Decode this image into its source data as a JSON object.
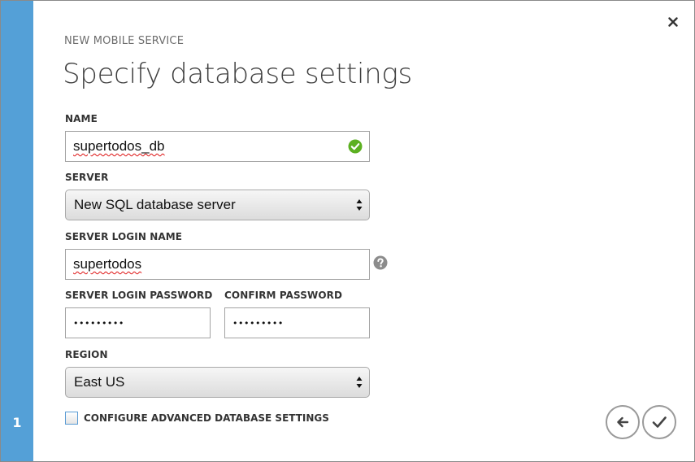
{
  "wizard": {
    "step_number": "1",
    "subtitle": "NEW MOBILE SERVICE",
    "title": "Specify database settings"
  },
  "form": {
    "name": {
      "label": "NAME",
      "value": "supertodos_db",
      "status_icon": "check-circle-icon",
      "status_color": "#5cb021"
    },
    "server": {
      "label": "SERVER",
      "selected": "New SQL database server"
    },
    "server_login_name": {
      "label": "SERVER LOGIN NAME",
      "value": "supertodos",
      "help_icon": "question-circle-icon"
    },
    "server_login_password": {
      "label": "SERVER LOGIN PASSWORD",
      "value": "•••••••••"
    },
    "confirm_password": {
      "label": "CONFIRM PASSWORD",
      "value": "•••••••••"
    },
    "region": {
      "label": "REGION",
      "selected": "East US"
    },
    "advanced_settings": {
      "label": "CONFIGURE ADVANCED DATABASE SETTINGS",
      "checked": false
    }
  },
  "colors": {
    "step_rail": "#54a0d7",
    "checkbox_border": "#5a9bd4"
  },
  "icons": {
    "close": "close-icon",
    "back": "arrow-left-icon",
    "complete": "checkmark-icon"
  }
}
